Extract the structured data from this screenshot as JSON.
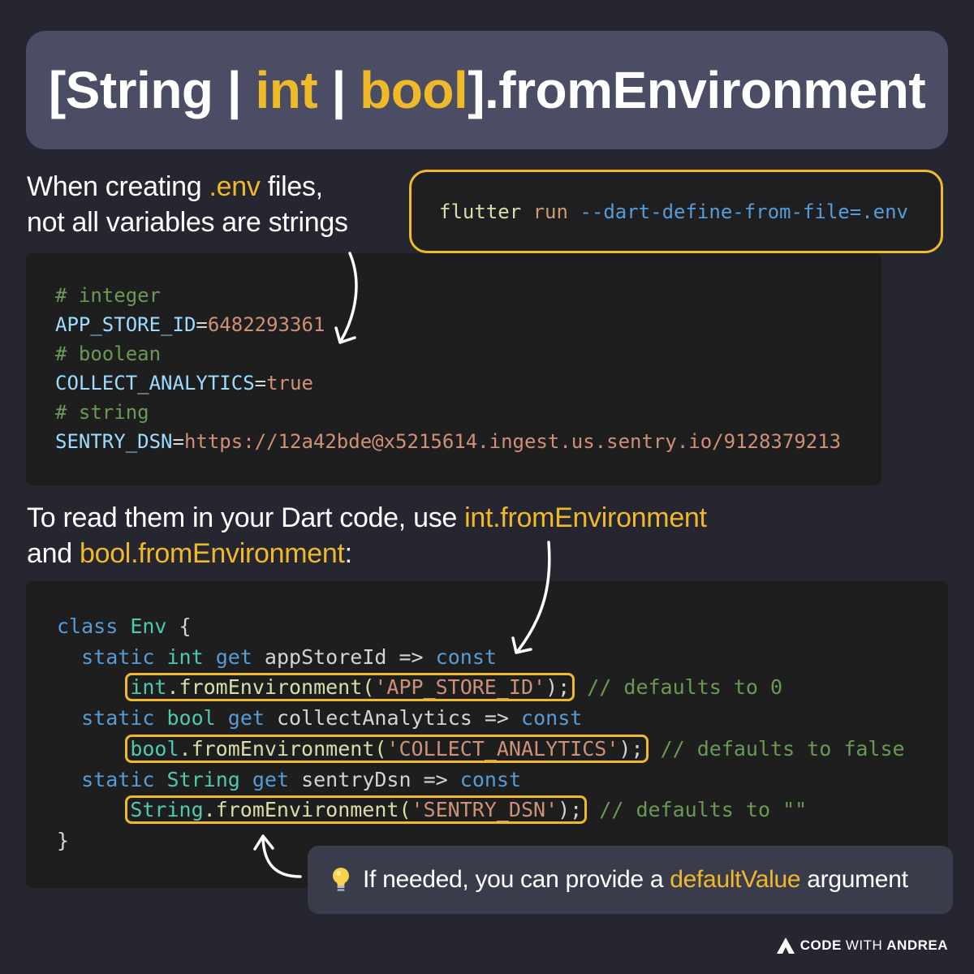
{
  "title": {
    "open": "[",
    "string": "String",
    "sep1": " | ",
    "int": "int",
    "sep2": " | ",
    "bool": "bool",
    "close": "].fromEnvironment"
  },
  "intro": {
    "part1": "When creating ",
    "highlight": ".env",
    "part2": " files,",
    "line2": "not all variables are strings"
  },
  "command": {
    "program": "flutter",
    "subcommand": "run",
    "flag": "--dart-define-from-file=.env"
  },
  "env_file": {
    "comment_integer": "# integer",
    "app_store_key": "APP_STORE_ID",
    "app_store_value": "6482293361",
    "comment_boolean": "# boolean",
    "analytics_key": "COLLECT_ANALYTICS",
    "analytics_value": "true",
    "comment_string": "# string",
    "sentry_key": "SENTRY_DSN",
    "sentry_value": "https://12a42bde@x5215614.ingest.us.sentry.io/9128379213",
    "equals": "="
  },
  "mid_text": {
    "part1": "To read them in your Dart code, use ",
    "highlight1": "int.fromEnvironment",
    "part2": "and ",
    "highlight2": "bool.fromEnvironment",
    "part3": ":"
  },
  "dart_code": {
    "class_kw": "class",
    "class_name": "Env",
    "open_brace": " {",
    "static_kw": "static",
    "get_kw": "get",
    "arrow": "=>",
    "const_kw": "const",
    "int_type": "int",
    "bool_type": "bool",
    "string_type": "String",
    "app_getter": "appStoreId",
    "analytics_getter": "collectAnalytics",
    "sentry_getter": "sentryDsn",
    "from_env": ".fromEnvironment(",
    "arg_app": "'APP_STORE_ID'",
    "arg_analytics": "'COLLECT_ANALYTICS'",
    "arg_sentry": "'SENTRY_DSN'",
    "call_end": ");",
    "comment_app": "// defaults to 0",
    "comment_analytics": "// defaults to false",
    "comment_sentry": "// defaults to \"\"",
    "close_brace": "}"
  },
  "tip": {
    "part1": "If needed, you can provide a ",
    "highlight": "defaultValue",
    "part2": " argument"
  },
  "brand": {
    "code": "CODE",
    "with": "WITH",
    "andrea": "ANDREA"
  },
  "colors": {
    "background": "#252630",
    "title_bar": "#4a4d63",
    "accent": "#f0b92a",
    "code_bg": "#1e1e1f",
    "tip_bg": "#3a3c4b"
  }
}
